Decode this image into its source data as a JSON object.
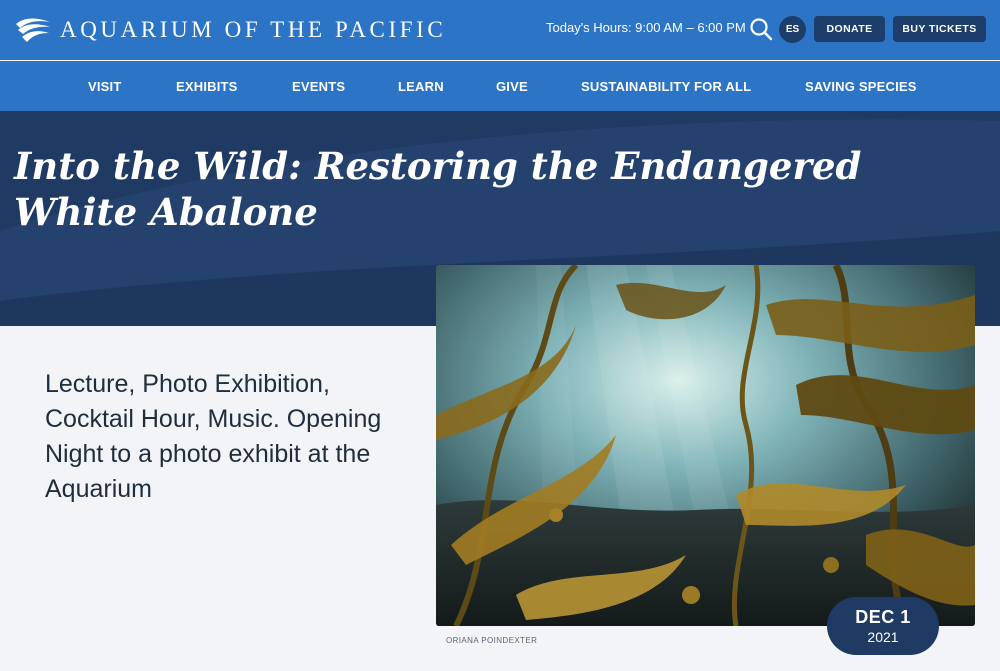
{
  "brand": {
    "name": "AQUARIUM OF THE PACIFIC",
    "color_primary": "#2b74c6",
    "color_dark": "#1f3b63"
  },
  "header": {
    "hours": "Today's Hours: 9:00 AM – 6:00 PM",
    "language_label": "ES",
    "donate_label": "DONATE",
    "tickets_label": "BUY TICKETS",
    "search_icon": "search-icon"
  },
  "nav": {
    "items": [
      {
        "label": "VISIT"
      },
      {
        "label": "EXHIBITS"
      },
      {
        "label": "EVENTS"
      },
      {
        "label": "LEARN"
      },
      {
        "label": "GIVE"
      },
      {
        "label": "SUSTAINABILITY FOR ALL"
      },
      {
        "label": "SAVING SPECIES"
      }
    ]
  },
  "event": {
    "title": "Into the Wild: Restoring the Endangered White Abalone",
    "description": "Lecture, Photo Exhibition, Cocktail Hour, Music. Opening Night to a photo exhibit at the Aquarium",
    "photo_credit": "ORIANA POINDEXTER",
    "date": {
      "day": "DEC 1",
      "year": "2021"
    }
  }
}
